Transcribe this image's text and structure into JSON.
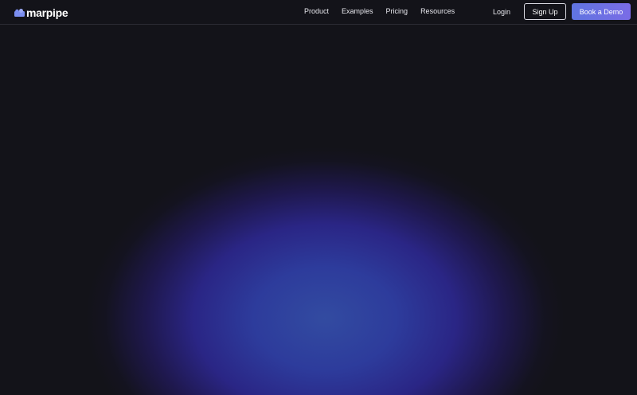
{
  "brand": {
    "name": "marpipe",
    "icon": "marpipe-logo-icon",
    "color": "#7b8ef0"
  },
  "nav": {
    "links": [
      "Product",
      "Examples",
      "Pricing",
      "Resources"
    ]
  },
  "auth": {
    "login_label": "Login",
    "signup_label": "Sign Up",
    "demo_label": "Book a Demo"
  },
  "colors": {
    "background": "#131319",
    "accent_gradient_start": "#5f74e0",
    "accent_gradient_end": "#7a6ce6",
    "glow": "#3040aa"
  }
}
